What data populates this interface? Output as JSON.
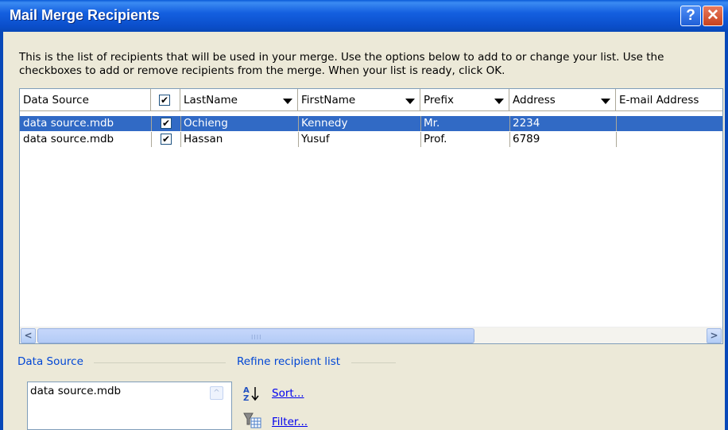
{
  "window": {
    "title": "Mail Merge Recipients",
    "help_glyph": "?",
    "close_glyph": "✕"
  },
  "instructions": "This is the list of recipients that will be used in your merge.  Use the options below to add to or change your list.  Use the checkboxes to add or remove recipients from the merge.  When your list is ready, click OK.",
  "table": {
    "columns": [
      "Data Source",
      "",
      "LastName",
      "FirstName",
      "Prefix",
      "Address",
      "E-mail Address"
    ],
    "header_checkbox": "✔",
    "rows": [
      {
        "source": "data source.mdb",
        "checked": "✔",
        "last": "Ochieng",
        "first": "Kennedy",
        "prefix": "Mr.",
        "address": "2234",
        "email": "",
        "selected": true
      },
      {
        "source": "data source.mdb",
        "checked": "✔",
        "last": "Hassan",
        "first": "Yusuf",
        "prefix": "Prof.",
        "address": "6789",
        "email": "",
        "selected": false
      }
    ],
    "scroll_left": "<",
    "scroll_right": ">",
    "scroll_grip": "IIII"
  },
  "data_source_section": {
    "label": "Data Source",
    "items": [
      "data source.mdb"
    ],
    "scroll_up": "^"
  },
  "refine_section": {
    "label": "Refine recipient list",
    "sort_label": "Sort...",
    "filter_label": "Filter..."
  },
  "colors": {
    "titlebar": "#0B4FCC",
    "selection": "#316AC5",
    "link": "#0000EE",
    "group_label": "#0046D5"
  },
  "icons": [
    "help-icon",
    "close-icon",
    "sort-az-icon",
    "filter-icon",
    "scroll-left-icon",
    "scroll-right-icon",
    "scroll-up-icon"
  ]
}
